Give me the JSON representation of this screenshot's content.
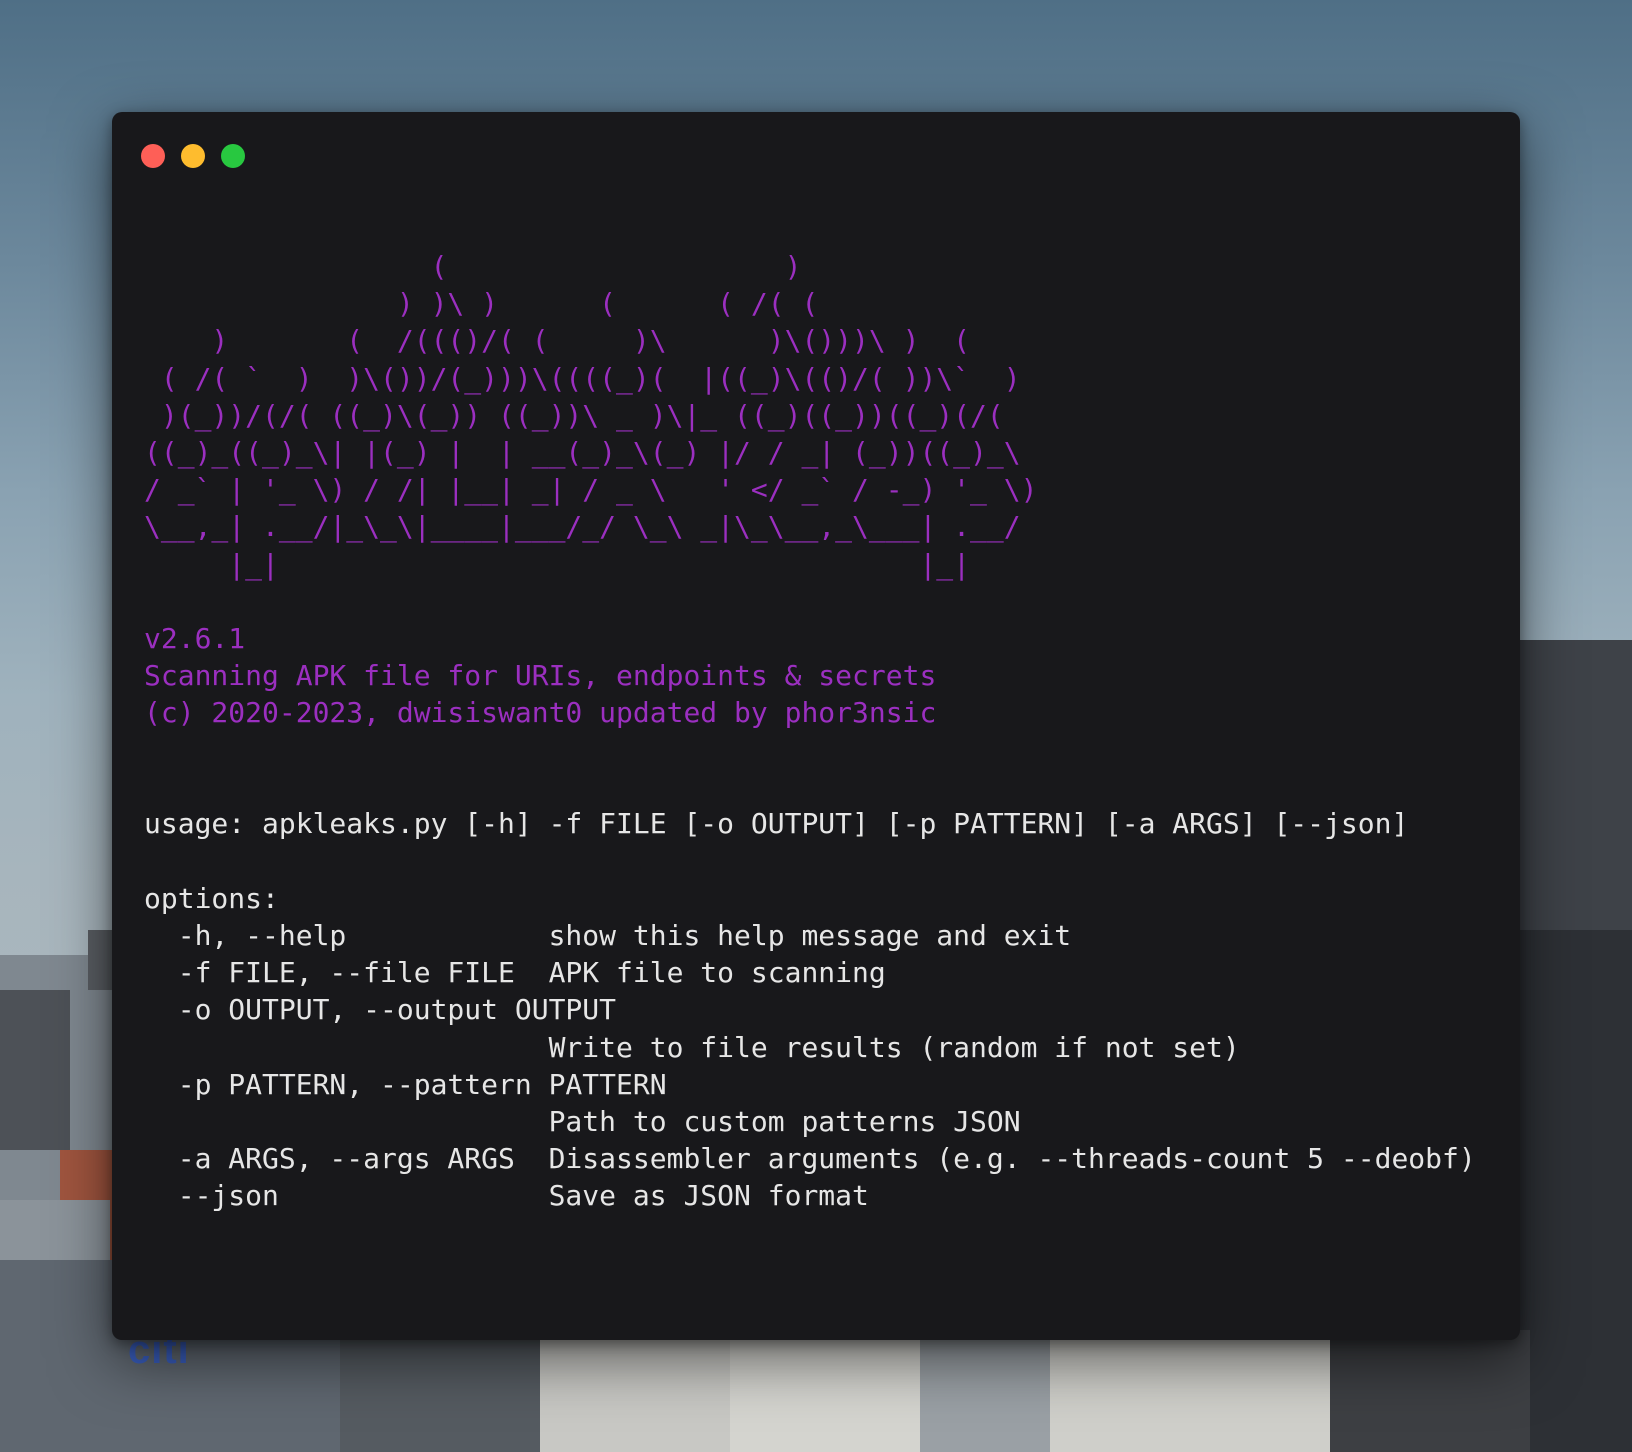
{
  "window": {
    "controls": [
      "close",
      "minimize",
      "zoom"
    ]
  },
  "background": {
    "sign_text": "citi"
  },
  "banner": {
    "ascii_art": "                 (                    )\n               ) )\\ )      (      ( /( (\n    )       (  /((()/( (     )\\      )\\()))\\ )  (\n ( /( `  )  )\\())/(_)))\\((((_)(  |((_)\\(()/( ))\\`  )\n )(_))/(/( ((_)\\(_)) ((_))\\ _ )\\|_ ((_)((_))((_)(/(\n((_)_((_)_\\| |(_) |  | __(_)_\\(_) |/ / _| (_))((_)_\\\n/ _` | '_ \\) / /| |__| _| / _ \\   ' </ _` / -_) '_ \\)\n\\__,_| .__/|_\\_\\|____|___/_/ \\_\\ _|\\_\\__,_\\___| .__/\n     |_|                                      |_|"
  },
  "info": {
    "version": "v2.6.1",
    "description": "Scanning APK file for URIs, endpoints & secrets",
    "copyright": "(c) 2020-2023, dwisiswant0 updated by phor3nsic"
  },
  "help": {
    "usage": "usage: apkleaks.py [-h] -f FILE [-o OUTPUT] [-p PATTERN] [-a ARGS] [--json]",
    "options_header": "options:",
    "lines": [
      "  -h, --help            show this help message and exit",
      "  -f FILE, --file FILE  APK file to scanning",
      "  -o OUTPUT, --output OUTPUT",
      "                        Write to file results (random if not set)",
      "  -p PATTERN, --pattern PATTERN",
      "                        Path to custom patterns JSON",
      "  -a ARGS, --args ARGS  Disassembler arguments (e.g. --threads-count 5 --deobf)",
      "  --json                Save as JSON format"
    ]
  },
  "colors": {
    "terminal_bg": "#18181b",
    "banner": "#9b2fc0",
    "text": "#e6e6e6",
    "close": "#fe5f57",
    "minimize": "#febc2e",
    "zoom": "#28c840"
  }
}
